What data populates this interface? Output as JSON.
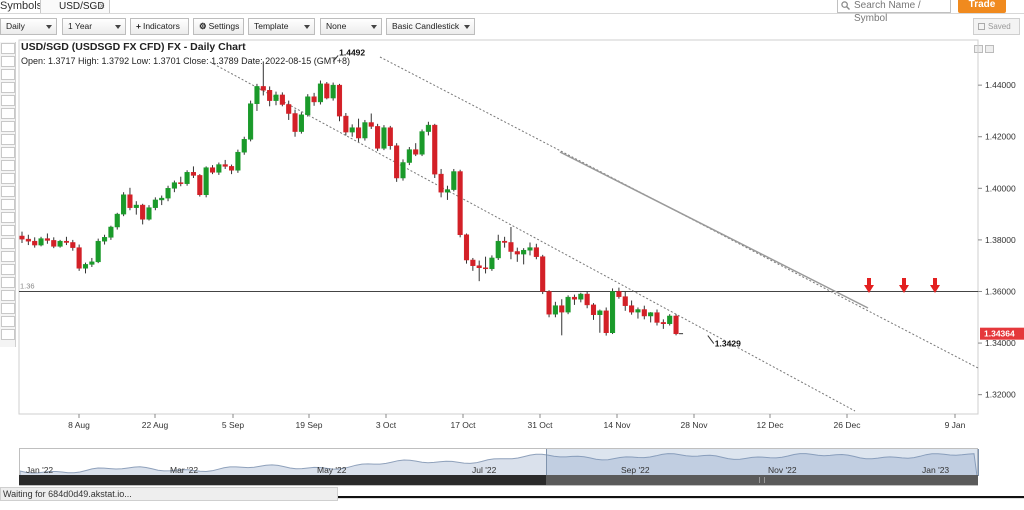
{
  "topbar": {
    "symbols_label": "Symbols:",
    "symbol_tab": "USD/SGD",
    "search_placeholder": "Search Name / Symbol",
    "trade_label": "Trade"
  },
  "toolbar": {
    "interval": "Daily",
    "range": "1 Year",
    "indicators": "Indicators",
    "settings": "Settings",
    "template": "Template",
    "overlay": "None",
    "chart_style": "Basic Candlestick",
    "saved": "Saved"
  },
  "chart_header": {
    "title": "USD/SGD (USDSGD FX CFD) FX - Daily Chart",
    "ohlc": "Open: 1.3717  High: 1.3792  Low: 1.3701  Close: 1.3789  Date: 2022-08-15 (GMT+8)"
  },
  "chart_data": {
    "type": "candlestick",
    "x_ticks": [
      "8 Aug",
      "22 Aug",
      "5 Sep",
      "19 Sep",
      "3 Oct",
      "17 Oct",
      "31 Oct",
      "14 Nov",
      "28 Nov",
      "12 Dec",
      "26 Dec",
      "9 Jan"
    ],
    "y_ticks": [
      "1.32000",
      "1.34000",
      "1.36000",
      "1.38000",
      "1.40000",
      "1.42000",
      "1.44000"
    ],
    "ylim": [
      1.3125,
      1.4575
    ],
    "last_price": "1.34364",
    "horizontal_line": {
      "value": 1.36,
      "label": "1.36"
    },
    "annotations": [
      {
        "text": "1.4492",
        "date_index": 49,
        "price": 1.4492
      },
      {
        "text": "1.3429",
        "date_index": 108,
        "price": 1.3429
      }
    ],
    "arrows": [
      "sell-arrow",
      "sell-arrow",
      "sell-arrow"
    ],
    "colors": {
      "up": "#1a9a2a",
      "down": "#d32027",
      "wick": "#333333",
      "price_tag": "#e5383b"
    },
    "ohlc": [
      [
        1.3815,
        1.3832,
        1.3788,
        1.3803
      ],
      [
        1.3803,
        1.382,
        1.378,
        1.3795
      ],
      [
        1.3795,
        1.381,
        1.377,
        1.378
      ],
      [
        1.378,
        1.3812,
        1.3775,
        1.3805
      ],
      [
        1.3805,
        1.3825,
        1.3785,
        1.3798
      ],
      [
        1.3798,
        1.381,
        1.3768,
        1.3775
      ],
      [
        1.3775,
        1.38,
        1.377,
        1.3795
      ],
      [
        1.3795,
        1.3812,
        1.378,
        1.379
      ],
      [
        1.379,
        1.38,
        1.3758,
        1.377
      ],
      [
        1.377,
        1.3782,
        1.368,
        1.369
      ],
      [
        1.369,
        1.3712,
        1.367,
        1.3705
      ],
      [
        1.3705,
        1.373,
        1.3695,
        1.3715
      ],
      [
        1.3715,
        1.3805,
        1.371,
        1.3795
      ],
      [
        1.3795,
        1.382,
        1.3782,
        1.381
      ],
      [
        1.381,
        1.3855,
        1.38,
        1.385
      ],
      [
        1.385,
        1.3905,
        1.384,
        1.39
      ],
      [
        1.39,
        1.3985,
        1.3892,
        1.3975
      ],
      [
        1.3975,
        1.4002,
        1.3915,
        1.3925
      ],
      [
        1.3925,
        1.395,
        1.3898,
        1.3935
      ],
      [
        1.3935,
        1.394,
        1.386,
        1.388
      ],
      [
        1.388,
        1.3935,
        1.3875,
        1.3925
      ],
      [
        1.3925,
        1.3965,
        1.3915,
        1.3955
      ],
      [
        1.3955,
        1.3972,
        1.3935,
        1.3962
      ],
      [
        1.3962,
        1.401,
        1.395,
        1.4
      ],
      [
        1.4,
        1.403,
        1.3985,
        1.4022
      ],
      [
        1.4022,
        1.4045,
        1.4008,
        1.4018
      ],
      [
        1.4018,
        1.407,
        1.401,
        1.4062
      ],
      [
        1.4062,
        1.4085,
        1.404,
        1.405
      ],
      [
        1.405,
        1.4055,
        1.3968,
        1.3975
      ],
      [
        1.3975,
        1.4085,
        1.3965,
        1.408
      ],
      [
        1.408,
        1.409,
        1.4055,
        1.4062
      ],
      [
        1.4062,
        1.41,
        1.4052,
        1.4092
      ],
      [
        1.4092,
        1.411,
        1.4075,
        1.4085
      ],
      [
        1.4085,
        1.4092,
        1.4055,
        1.407
      ],
      [
        1.407,
        1.415,
        1.406,
        1.414
      ],
      [
        1.414,
        1.42,
        1.413,
        1.419
      ],
      [
        1.419,
        1.434,
        1.4182,
        1.4328
      ],
      [
        1.4328,
        1.4405,
        1.43,
        1.4395
      ],
      [
        1.4395,
        1.4492,
        1.436,
        1.438
      ],
      [
        1.438,
        1.4395,
        1.4318,
        1.434
      ],
      [
        1.434,
        1.4375,
        1.4322,
        1.4362
      ],
      [
        1.4362,
        1.4372,
        1.4318,
        1.4325
      ],
      [
        1.4325,
        1.434,
        1.4265,
        1.429
      ],
      [
        1.429,
        1.4305,
        1.42,
        1.422
      ],
      [
        1.422,
        1.4295,
        1.4212,
        1.4285
      ],
      [
        1.4285,
        1.4365,
        1.4278,
        1.4355
      ],
      [
        1.4355,
        1.437,
        1.432,
        1.4335
      ],
      [
        1.4335,
        1.4418,
        1.4325,
        1.4405
      ],
      [
        1.4405,
        1.4412,
        1.4345,
        1.435
      ],
      [
        1.435,
        1.441,
        1.434,
        1.44
      ],
      [
        1.44,
        1.4405,
        1.426,
        1.428
      ],
      [
        1.428,
        1.4292,
        1.4205,
        1.4218
      ],
      [
        1.4218,
        1.4248,
        1.42,
        1.4235
      ],
      [
        1.4235,
        1.427,
        1.418,
        1.4195
      ],
      [
        1.4195,
        1.4265,
        1.4185,
        1.4255
      ],
      [
        1.4255,
        1.429,
        1.423,
        1.424
      ],
      [
        1.424,
        1.425,
        1.4145,
        1.4155
      ],
      [
        1.4155,
        1.4245,
        1.4148,
        1.4235
      ],
      [
        1.4235,
        1.4242,
        1.415,
        1.4165
      ],
      [
        1.4165,
        1.4175,
        1.4025,
        1.404
      ],
      [
        1.404,
        1.4112,
        1.403,
        1.41
      ],
      [
        1.41,
        1.416,
        1.409,
        1.415
      ],
      [
        1.415,
        1.4175,
        1.4125,
        1.4132
      ],
      [
        1.4132,
        1.4228,
        1.4125,
        1.422
      ],
      [
        1.422,
        1.4258,
        1.4205,
        1.4245
      ],
      [
        1.4245,
        1.425,
        1.404,
        1.4055
      ],
      [
        1.4055,
        1.4075,
        1.3965,
        1.3985
      ],
      [
        1.3985,
        1.401,
        1.3955,
        1.3995
      ],
      [
        1.3995,
        1.4075,
        1.3988,
        1.4065
      ],
      [
        1.4065,
        1.4072,
        1.381,
        1.382
      ],
      [
        1.382,
        1.3825,
        1.3708,
        1.3722
      ],
      [
        1.3722,
        1.373,
        1.368,
        1.37
      ],
      [
        1.37,
        1.372,
        1.364,
        1.3692
      ],
      [
        1.3692,
        1.3735,
        1.367,
        1.3688
      ],
      [
        1.3688,
        1.374,
        1.368,
        1.373
      ],
      [
        1.373,
        1.382,
        1.3722,
        1.3795
      ],
      [
        1.3795,
        1.3812,
        1.377,
        1.379
      ],
      [
        1.379,
        1.385,
        1.3725,
        1.3755
      ],
      [
        1.3755,
        1.377,
        1.3715,
        1.3745
      ],
      [
        1.3745,
        1.3768,
        1.3705,
        1.376
      ],
      [
        1.376,
        1.379,
        1.374,
        1.377
      ],
      [
        1.377,
        1.3785,
        1.3725,
        1.3735
      ],
      [
        1.3735,
        1.3742,
        1.359,
        1.36
      ],
      [
        1.36,
        1.3605,
        1.35,
        1.3512
      ],
      [
        1.3512,
        1.356,
        1.35,
        1.3545
      ],
      [
        1.3545,
        1.357,
        1.343,
        1.352
      ],
      [
        1.352,
        1.3585,
        1.3512,
        1.3578
      ],
      [
        1.3578,
        1.3588,
        1.3548,
        1.357
      ],
      [
        1.357,
        1.3595,
        1.3558,
        1.359
      ],
      [
        1.359,
        1.36,
        1.3535,
        1.3548
      ],
      [
        1.3548,
        1.3555,
        1.349,
        1.351
      ],
      [
        1.351,
        1.353,
        1.344,
        1.3525
      ],
      [
        1.3525,
        1.3538,
        1.3429,
        1.344
      ],
      [
        1.344,
        1.3612,
        1.3435,
        1.36
      ],
      [
        1.36,
        1.3615,
        1.3572,
        1.358
      ],
      [
        1.358,
        1.36,
        1.3525,
        1.3545
      ],
      [
        1.3545,
        1.3565,
        1.351,
        1.352
      ],
      [
        1.352,
        1.3538,
        1.3495,
        1.353
      ],
      [
        1.353,
        1.3545,
        1.3492,
        1.3505
      ],
      [
        1.3505,
        1.352,
        1.348,
        1.3518
      ],
      [
        1.3518,
        1.353,
        1.3468,
        1.348
      ],
      [
        1.348,
        1.3492,
        1.3455,
        1.3475
      ],
      [
        1.3475,
        1.3512,
        1.3468,
        1.3505
      ],
      [
        1.3505,
        1.3512,
        1.343,
        1.3436
      ]
    ]
  },
  "navigator": {
    "labels": [
      "Jan '22",
      "Mar '22",
      "May '22",
      "Jul '22",
      "Sep '22",
      "Nov '22",
      "Jan '23"
    ]
  },
  "status": {
    "text": "Waiting for 684d0d49.akstat.io..."
  }
}
